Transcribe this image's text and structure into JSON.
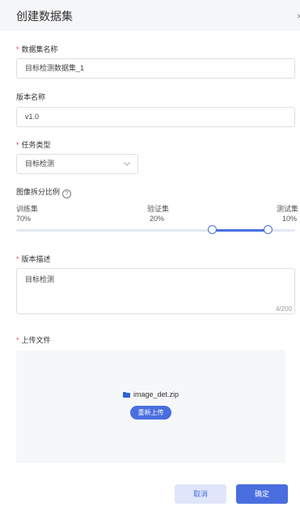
{
  "dialog": {
    "title": "创建数据集",
    "close_icon": "×"
  },
  "dataset_name": {
    "label": "数据集名称",
    "value": "目标检测数据集_1"
  },
  "version_name": {
    "label": "版本名称",
    "value": "v1.0"
  },
  "task_type": {
    "label": "任务类型",
    "value": "目标检测"
  },
  "split": {
    "label": "图像拆分比例",
    "help_icon": "?",
    "train_label": "训练集",
    "train_value": "70%",
    "val_label": "验证集",
    "val_value": "20%",
    "test_label": "测试集",
    "test_value": "10%",
    "train_fraction": 0.7,
    "val_fraction": 0.2,
    "test_fraction": 0.1
  },
  "description": {
    "label": "版本描述",
    "value": "目标检测",
    "counter": "4/200"
  },
  "upload": {
    "label": "上传文件",
    "file_name": "image_det.zip",
    "reupload_label": "重新上传"
  },
  "footer": {
    "cancel_label": "取消",
    "confirm_label": "确定"
  },
  "colors": {
    "primary": "#4a6ee0",
    "required": "#ef4444",
    "header_bg": "#f5f6f8"
  }
}
